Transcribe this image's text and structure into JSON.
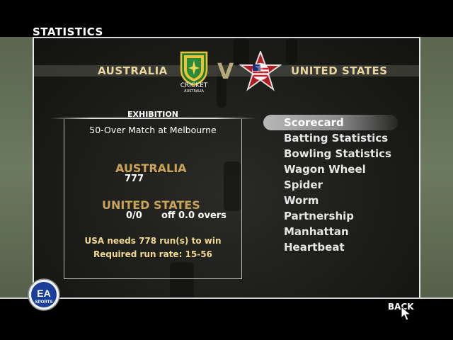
{
  "screen": {
    "title": "STATISTICS"
  },
  "matchup": {
    "home_team": "AUSTRALIA",
    "away_team": "UNITED STATES",
    "vs": "V",
    "home_logo": {
      "icon": "cricket-australia-logo-icon",
      "line1": "CRICKET",
      "line2": "AUSTRALIA"
    },
    "away_logo": {
      "icon": "usa-star-emblem-icon"
    }
  },
  "match_info": {
    "heading": "EXHIBITION",
    "description": "50-Over Match at Melbourne",
    "innings": [
      {
        "team": "AUSTRALIA",
        "score": "777",
        "overs": ""
      },
      {
        "team": "UNITED STATES",
        "score": "0/0",
        "overs": "off 0.0 overs"
      }
    ],
    "target": "USA needs 778 run(s) to win",
    "required_rate": "Required run rate: 15-56"
  },
  "menu": {
    "selected_index": 0,
    "items": [
      "Scorecard",
      "Batting Statistics",
      "Bowling Statistics",
      "Wagon Wheel",
      "Spider",
      "Worm",
      "Partnership",
      "Manhattan",
      "Heartbeat"
    ]
  },
  "footer": {
    "back_label": "BACK",
    "ea_logo": {
      "icon": "ea-sports-logo-icon",
      "line1": "EA",
      "line2": "SPORTS"
    }
  },
  "colors": {
    "team_name": "#e9d5a0",
    "score_team": "#c9a35a",
    "info_text": "#f0d890",
    "menu_highlight": "#b8b8b8"
  }
}
